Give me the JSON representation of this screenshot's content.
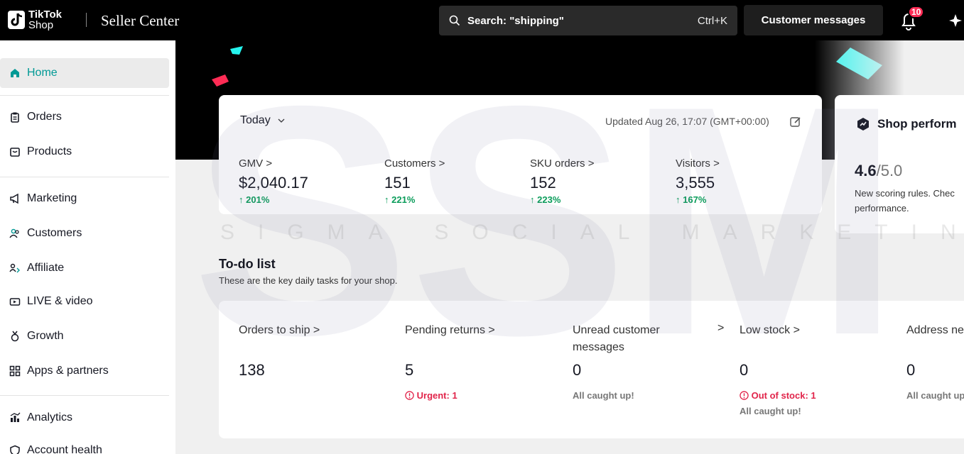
{
  "header": {
    "logo_line1": "TikTok",
    "logo_line2": "Shop",
    "app_title": "Seller Center",
    "search_placeholder": "Search: \"shipping\"",
    "search_shortcut": "Ctrl+K",
    "customer_messages": "Customer messages",
    "notification_count": "10"
  },
  "sidebar": {
    "items": [
      {
        "label": "Home",
        "icon": "home-icon",
        "active": true
      },
      {
        "label": "Orders",
        "icon": "clipboard-icon"
      },
      {
        "label": "Products",
        "icon": "box-icon"
      },
      {
        "label": "Marketing",
        "icon": "megaphone-icon"
      },
      {
        "label": "Customers",
        "icon": "users-icon"
      },
      {
        "label": "Affiliate",
        "icon": "affiliate-icon"
      },
      {
        "label": "LIVE & video",
        "icon": "video-icon"
      },
      {
        "label": "Growth",
        "icon": "medal-icon"
      },
      {
        "label": "Apps & partners",
        "icon": "grid-icon"
      },
      {
        "label": "Analytics",
        "icon": "bar-chart-icon"
      },
      {
        "label": "Account health",
        "icon": "shield-icon"
      }
    ]
  },
  "summary": {
    "period": "Today",
    "updated": "Updated Aug 26, 17:07 (GMT+00:00)",
    "metrics": [
      {
        "label": "GMV >",
        "value": "$2,040.17",
        "delta": "201%"
      },
      {
        "label": "Customers >",
        "value": "151",
        "delta": "221%"
      },
      {
        "label": "SKU orders >",
        "value": "152",
        "delta": "223%"
      },
      {
        "label": "Visitors >",
        "value": "3,555",
        "delta": "167%"
      }
    ]
  },
  "performance": {
    "title": "Shop perform",
    "score": "4.6",
    "score_max": "/5.0",
    "note": "New scoring rules. Chec performance."
  },
  "todo": {
    "title": "To-do list",
    "subtitle": "These are the key daily tasks for your shop.",
    "tasks": [
      {
        "label": "Orders to ship >",
        "count": "138",
        "status": ""
      },
      {
        "label": "Pending returns >",
        "count": "5",
        "status": "Urgent: 1"
      },
      {
        "label": "Unread customer messages",
        "count": "0",
        "status": "All caught up!"
      },
      {
        "label": "Low stock >",
        "count": "0",
        "status": "Out of stock: 1",
        "status2": "All caught up!"
      },
      {
        "label": "Address ne",
        "count": "0",
        "status": "All caught up"
      }
    ],
    "separator_chevron": ">"
  },
  "watermark": "SIGMA SOCIAL MARKETING",
  "colors": {
    "accent": "#009995",
    "positive": "#0a9c5a",
    "urgent": "#e1244a",
    "badge": "#fe2c55"
  }
}
